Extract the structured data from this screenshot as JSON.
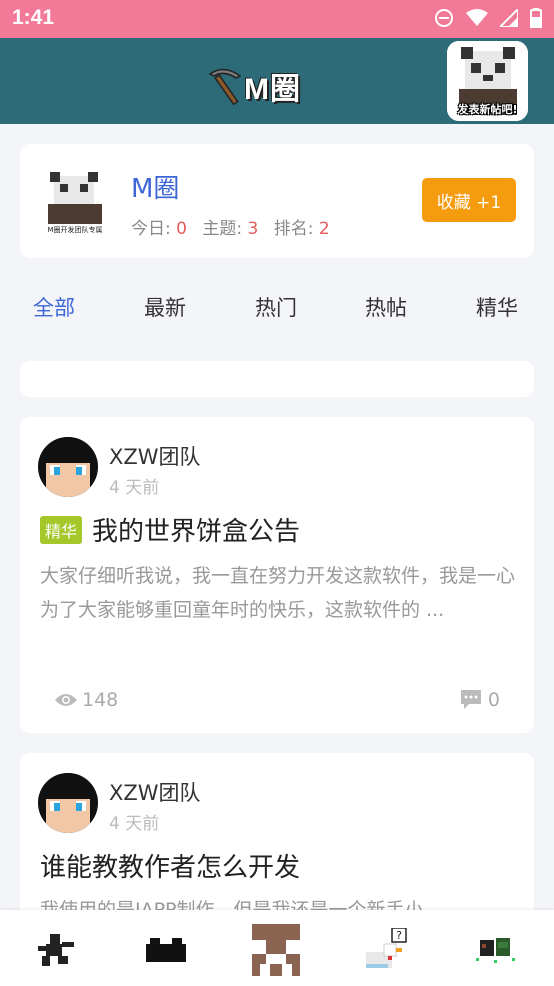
{
  "status_bar": {
    "time": "1:41",
    "icons": [
      "do-not-disturb-icon",
      "wifi-icon",
      "signal-icon",
      "battery-icon"
    ]
  },
  "header": {
    "title": "M圈",
    "logo_icon": "pickaxe-icon",
    "post_button_label": "发表新帖吧!"
  },
  "forum": {
    "name": "M圈",
    "today_label": "今日:",
    "today_value": "0",
    "topics_label": "主题:",
    "topics_value": "3",
    "rank_label": "排名:",
    "rank_value": "2",
    "favorite_label": "收藏 +1",
    "avatar_caption": "M圈开发团队专属"
  },
  "tabs": [
    {
      "label": "全部",
      "active": true
    },
    {
      "label": "最新",
      "active": false
    },
    {
      "label": "热门",
      "active": false
    },
    {
      "label": "热帖",
      "active": false
    },
    {
      "label": "精华",
      "active": false
    }
  ],
  "posts": [
    {
      "author": "XZW团队",
      "time": "4 天前",
      "badge": "精华",
      "title": "我的世界饼盒公告",
      "excerpt": "大家仔细听我说，我一直在努力开发这款软件，我是一心为了大家能够重回童年时的快乐，这款软件的 ...",
      "views": "148",
      "comments": "0"
    },
    {
      "author": "XZW团队",
      "time": "4 天前",
      "title": "谁能教教作者怎么开发",
      "excerpt": "我使用的是IAPP制作，但是我还是一个新手小"
    }
  ],
  "bottom_nav": [
    "runner-icon",
    "grass-block-icon",
    "creeper-icon",
    "chicken-question-icon",
    "villager-icon"
  ],
  "colors": {
    "status_bar": "#f27a98",
    "header": "#2d6b78",
    "accent": "#3d66d6",
    "favorite": "#f59b0e",
    "badge": "#a6c72a",
    "stat_value": "#e55c5c"
  }
}
